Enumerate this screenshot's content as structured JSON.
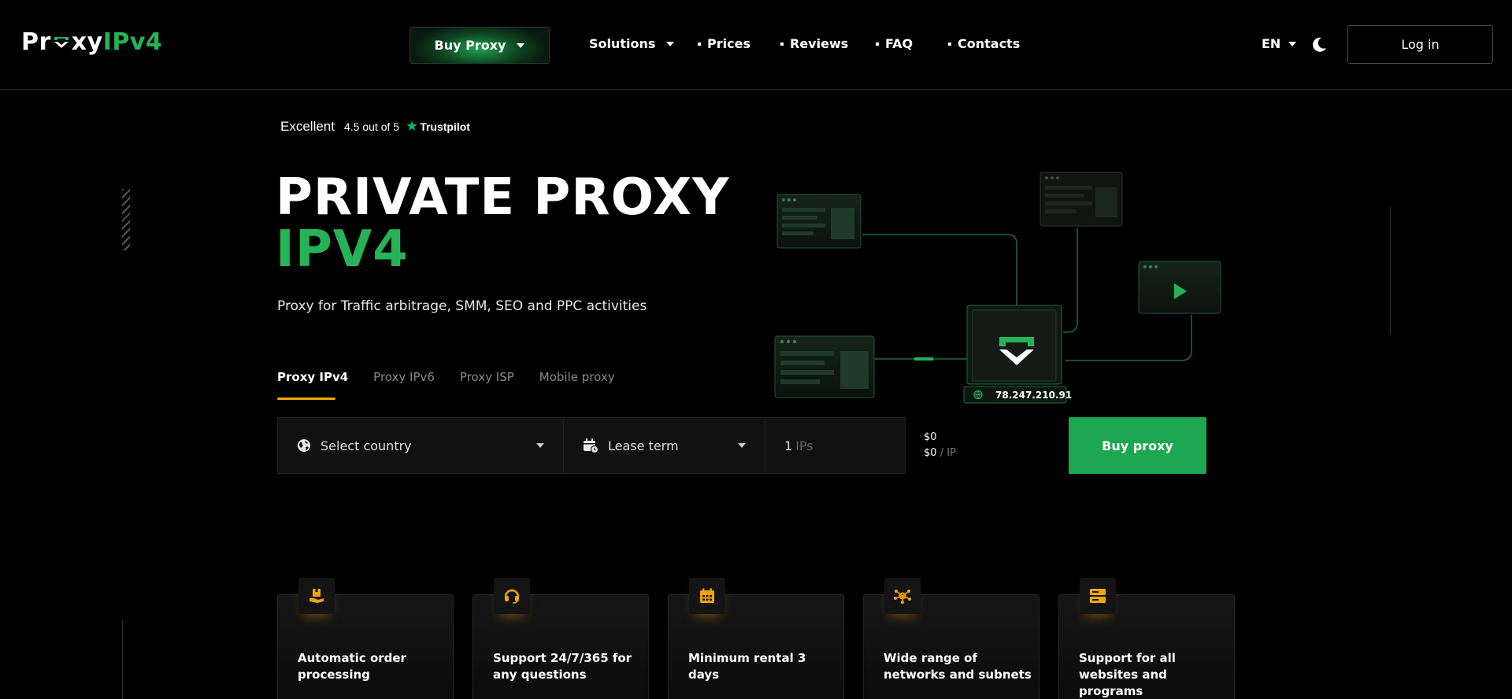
{
  "brand": {
    "logo_left": "Pr",
    "logo_mid": "xy",
    "logo_right": "IPv4"
  },
  "nav": {
    "buy_proxy": "Buy Proxy",
    "solutions": "Solutions",
    "prices": "Prices",
    "reviews": "Reviews",
    "faq": "FAQ",
    "contacts": "Contacts",
    "language": "EN",
    "login": "Log in"
  },
  "trustpilot": {
    "label": "Excellent",
    "rating": "4.5 out of 5",
    "brand": "Trustpilot"
  },
  "hero": {
    "title_line1": "PRIVATE PROXY",
    "title_line2": "IPV4",
    "subtitle": "Proxy for Traffic arbitrage, SMM, SEO and PPC activities"
  },
  "tabs": [
    {
      "label": "Proxy IPv4",
      "active": true
    },
    {
      "label": "Proxy IPv6",
      "active": false
    },
    {
      "label": "Proxy ISP",
      "active": false
    },
    {
      "label": "Mobile proxy",
      "active": false
    }
  ],
  "order_form": {
    "country_placeholder": "Select country",
    "lease_placeholder": "Lease term",
    "quantity": "1",
    "quantity_unit": "IPs",
    "total": "$0",
    "per_ip": "$0",
    "per_ip_unit": "/ IP",
    "buy_label": "Buy proxy"
  },
  "illustration": {
    "ip_address": "78.247.210.91"
  },
  "features": [
    {
      "icon": "box-hand-icon",
      "text": "Automatic order processing"
    },
    {
      "icon": "headset-icon",
      "text": "Support 24/7/365 for any questions"
    },
    {
      "icon": "calendar-icon",
      "text": "Minimum rental 3 days"
    },
    {
      "icon": "network-nodes-icon",
      "text": "Wide range of networks and subnets"
    },
    {
      "icon": "server-stack-icon",
      "text": "Support for all websites and programs"
    }
  ],
  "colors": {
    "accent_green": "#26b358",
    "button_green": "#1da750",
    "accent_orange": "#f0a500",
    "trustpilot_green": "#00b67a"
  }
}
